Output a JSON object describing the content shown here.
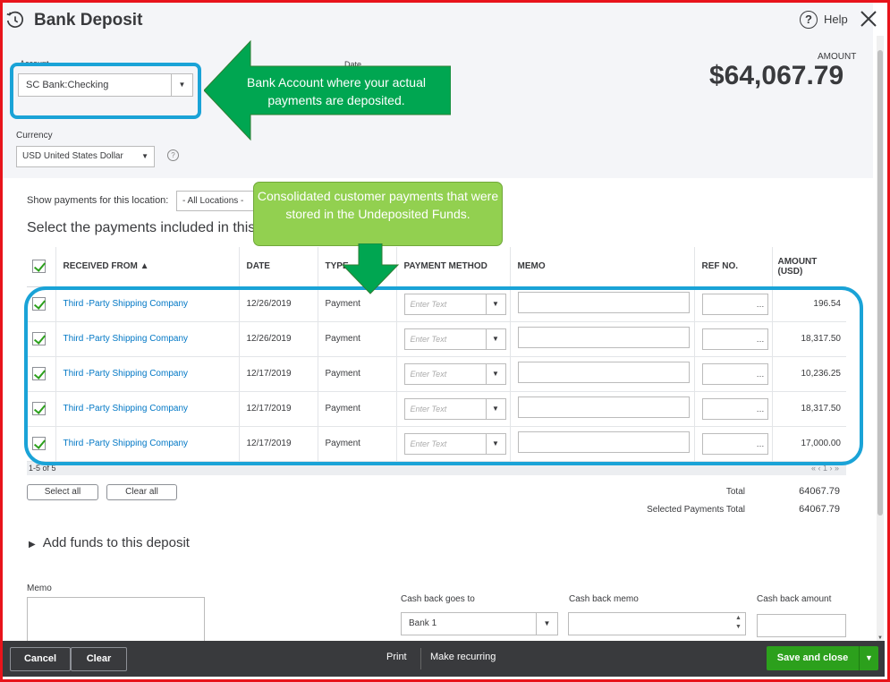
{
  "header": {
    "title": "Bank Deposit",
    "help_label": "Help",
    "account_label": "Account",
    "account_value": "SC Bank:Checking",
    "date_label": "Date",
    "amount_label": "AMOUNT",
    "amount_value": "$64,067.79",
    "currency_label": "Currency",
    "currency_value": "USD United States Dollar"
  },
  "location": {
    "label": "Show payments for this location:",
    "value": "- All Locations -"
  },
  "section_heading": "Select the payments included in this deposit",
  "table": {
    "columns": [
      "RECEIVED FROM ▲",
      "DATE",
      "TYPE",
      "PAYMENT METHOD",
      "MEMO",
      "REF NO.",
      "AMOUNT (USD)"
    ],
    "method_placeholder": "Enter Text",
    "rows": [
      {
        "from": "Third -Party Shipping Company",
        "date": "12/26/2019",
        "type": "Payment",
        "amount": "196.54"
      },
      {
        "from": "Third -Party Shipping Company",
        "date": "12/26/2019",
        "type": "Payment",
        "amount": "18,317.50"
      },
      {
        "from": "Third -Party Shipping Company",
        "date": "12/17/2019",
        "type": "Payment",
        "amount": "10,236.25"
      },
      {
        "from": "Third -Party Shipping Company",
        "date": "12/17/2019",
        "type": "Payment",
        "amount": "18,317.50"
      },
      {
        "from": "Third -Party Shipping Company",
        "date": "12/17/2019",
        "type": "Payment",
        "amount": "17,000.00"
      }
    ],
    "pager_text": "1-5 of 5",
    "pager_nav": "« ‹ 1 › »"
  },
  "totals": {
    "select_all": "Select all",
    "clear_all": "Clear all",
    "total_label": "Total",
    "total_value": "64067.79",
    "selected_label": "Selected Payments Total",
    "selected_value": "64067.79"
  },
  "add_funds": "Add funds to this deposit",
  "bottom": {
    "memo_label": "Memo",
    "cash_back_goes_label": "Cash back goes to",
    "cash_back_goes_value": "Bank 1",
    "cash_back_memo_label": "Cash back memo",
    "cash_back_amount_label": "Cash back amount"
  },
  "footer": {
    "cancel": "Cancel",
    "clear": "Clear",
    "print": "Print",
    "make_recurring": "Make recurring",
    "save": "Save and close"
  },
  "annotations": {
    "account_callout": "Bank Account where your actual payments are deposited.",
    "consolidated_callout": "Consolidated customer payments that were stored in the Undeposited Funds."
  },
  "colors": {
    "highlight": "#1aa3d7",
    "callout_dark": "#00a651",
    "callout_light": "#92d050",
    "accent_green": "#2ca01c",
    "frame": "#e8141b"
  }
}
